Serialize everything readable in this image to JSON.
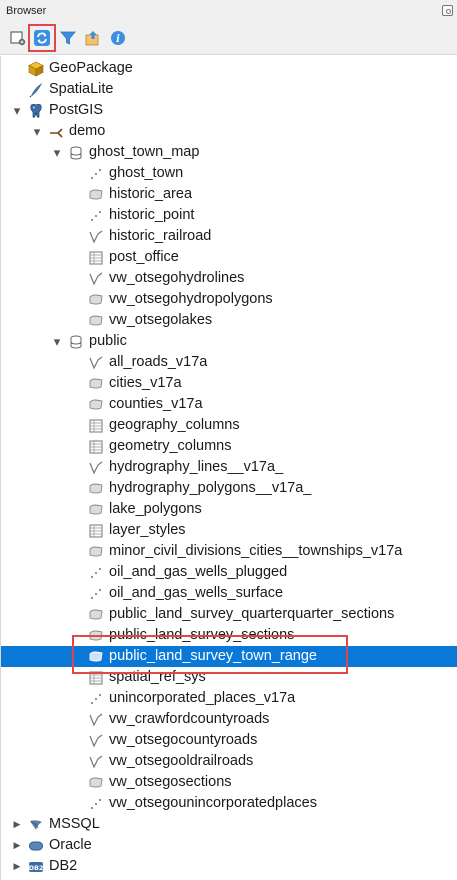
{
  "panel": {
    "title": "Browser"
  },
  "toolbar": {
    "buttons": [
      {
        "name": "add-selected-layers-button",
        "icon": "add-layer-icon"
      },
      {
        "name": "refresh-button",
        "icon": "refresh-icon",
        "highlighted": true
      },
      {
        "name": "filter-button",
        "icon": "filter-icon"
      },
      {
        "name": "collapse-all-button",
        "icon": "collapse-all-icon"
      },
      {
        "name": "properties-button",
        "icon": "info-icon"
      }
    ]
  },
  "tree": {
    "top": [
      {
        "label": "GeoPackage",
        "icon": "geopackage-icon"
      },
      {
        "label": "SpatiaLite",
        "icon": "spatialite-icon"
      },
      {
        "label": "PostGIS",
        "icon": "postgis-icon",
        "expanded": true
      }
    ],
    "connection": {
      "label": "demo",
      "icon": "connection-icon",
      "expanded": true
    },
    "schemas": [
      {
        "label": "ghost_town_map",
        "icon": "schema-icon",
        "expanded": true,
        "layers": [
          {
            "label": "ghost_town",
            "type": "point"
          },
          {
            "label": "historic_area",
            "type": "polygon"
          },
          {
            "label": "historic_point",
            "type": "point"
          },
          {
            "label": "historic_railroad",
            "type": "line"
          },
          {
            "label": "post_office",
            "type": "table"
          },
          {
            "label": "vw_otsegohydrolines",
            "type": "line"
          },
          {
            "label": "vw_otsegohydropolygons",
            "type": "polygon"
          },
          {
            "label": "vw_otsegolakes",
            "type": "polygon"
          }
        ]
      },
      {
        "label": "public",
        "icon": "schema-icon",
        "expanded": true,
        "layers": [
          {
            "label": "all_roads_v17a",
            "type": "line"
          },
          {
            "label": "cities_v17a",
            "type": "polygon"
          },
          {
            "label": "counties_v17a",
            "type": "polygon"
          },
          {
            "label": "geography_columns",
            "type": "table"
          },
          {
            "label": "geometry_columns",
            "type": "table"
          },
          {
            "label": "hydrography_lines__v17a_",
            "type": "line"
          },
          {
            "label": "hydrography_polygons__v17a_",
            "type": "polygon"
          },
          {
            "label": "lake_polygons",
            "type": "polygon"
          },
          {
            "label": "layer_styles",
            "type": "table"
          },
          {
            "label": "minor_civil_divisions_cities__townships_v17a",
            "type": "polygon"
          },
          {
            "label": "oil_and_gas_wells_plugged",
            "type": "point"
          },
          {
            "label": "oil_and_gas_wells_surface",
            "type": "point"
          },
          {
            "label": "public_land_survey_quarterquarter_sections",
            "type": "polygon"
          },
          {
            "label": "public_land_survey_sections",
            "type": "polygon"
          },
          {
            "label": "public_land_survey_town_range",
            "type": "polygon",
            "selected": true
          },
          {
            "label": "spatial_ref_sys",
            "type": "table"
          },
          {
            "label": "unincorporated_places_v17a",
            "type": "point"
          },
          {
            "label": "vw_crawfordcountyroads",
            "type": "line"
          },
          {
            "label": "vw_otsegocountyroads",
            "type": "line"
          },
          {
            "label": "vw_otsegooldrailroads",
            "type": "line"
          },
          {
            "label": "vw_otsegosections",
            "type": "polygon"
          },
          {
            "label": "vw_otsegounincorporatedplaces",
            "type": "point"
          }
        ]
      }
    ],
    "bottom": [
      {
        "label": "MSSQL",
        "icon": "mssql-icon",
        "expanded": false
      },
      {
        "label": "Oracle",
        "icon": "oracle-icon",
        "expanded": false
      },
      {
        "label": "DB2",
        "icon": "db2-icon",
        "expanded": false
      }
    ]
  },
  "colors": {
    "selection": "#0a78d7",
    "annotation_box": "#e0474c",
    "panel_bg": "#f0f0f0"
  }
}
